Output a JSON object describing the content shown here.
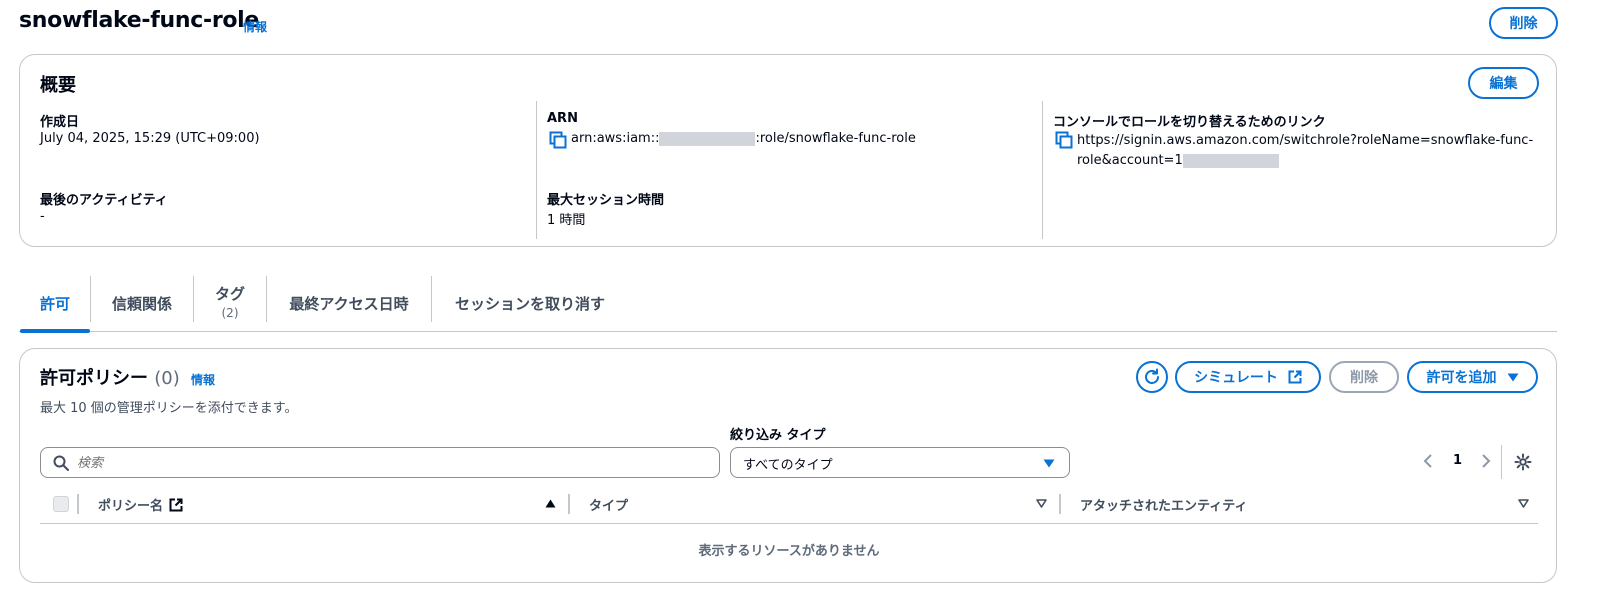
{
  "header": {
    "title": "snowflake-func-role",
    "info_label": "情報",
    "delete_label": "削除"
  },
  "summary": {
    "title": "概要",
    "edit_label": "編集",
    "created_label": "作成日",
    "created_value": "July 04, 2025, 15:29 (UTC+09:00)",
    "last_activity_label": "最後のアクティビティ",
    "last_activity_value": "-",
    "arn_label": "ARN",
    "arn_prefix": "arn:aws:iam::",
    "arn_suffix": ":role/snowflake-func-role",
    "max_session_label": "最大セッション時間",
    "max_session_value": "1 時間",
    "switch_link_label": "コンソールでロールを切り替えるためのリンク",
    "switch_link_line1": "https://signin.aws.amazon.com/switchrole?roleName=snowflake-func-",
    "switch_link_line2": "role&account=",
    "switch_link_line2_tail": "1"
  },
  "tabs": [
    {
      "label": "許可",
      "active": true
    },
    {
      "label": "信頼関係"
    },
    {
      "label": "タグ",
      "count": "(2)"
    },
    {
      "label": "最終アクセス日時"
    },
    {
      "label": "セッションを取り消す"
    }
  ],
  "policies": {
    "title": "許可ポリシー",
    "count": "(0)",
    "info_label": "情報",
    "description": "最大 10 個の管理ポリシーを添付できます。",
    "simulate_label": "シミュレート",
    "delete_label": "削除",
    "add_label": "許可を追加",
    "filter_type_label": "絞り込み タイプ",
    "search_placeholder": "検索",
    "type_select_value": "すべてのタイプ",
    "page_number": "1",
    "columns": [
      "ポリシー名",
      "タイプ",
      "アタッチされたエンティティ"
    ],
    "empty_message": "表示するリソースがありません"
  },
  "colors": {
    "accent": "#0972d3",
    "border": "#c6c6cd",
    "text": "#000716",
    "muted": "#5f6b7a",
    "disabled": "#9ba7b6"
  }
}
